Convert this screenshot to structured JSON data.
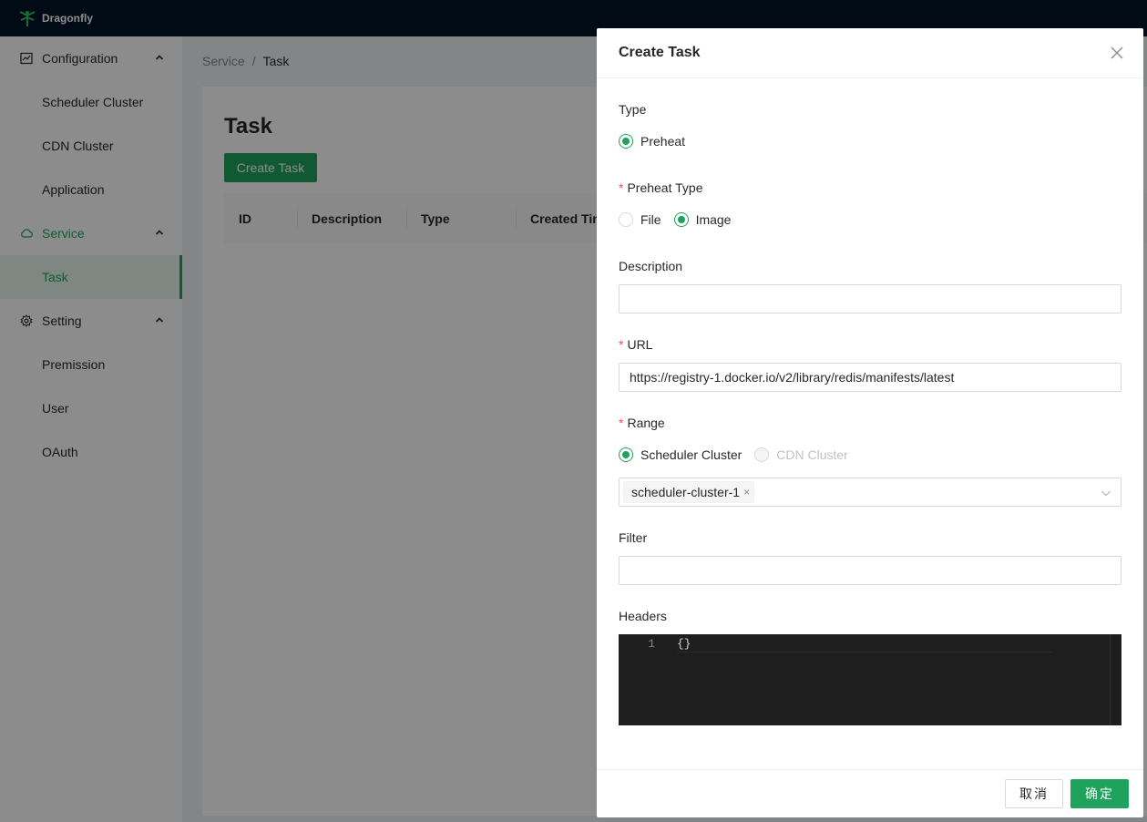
{
  "app": {
    "name": "Dragonfly"
  },
  "sidebar": {
    "items": [
      {
        "label": "Configuration",
        "icon": "chart-icon",
        "type": "group"
      },
      {
        "label": "Scheduler Cluster",
        "type": "sub"
      },
      {
        "label": "CDN Cluster",
        "type": "sub"
      },
      {
        "label": "Application",
        "type": "sub"
      },
      {
        "label": "Service",
        "icon": "cloud-icon",
        "type": "group",
        "active": true
      },
      {
        "label": "Task",
        "type": "sub",
        "selected": true
      },
      {
        "label": "Setting",
        "icon": "gear-icon",
        "type": "group"
      },
      {
        "label": "Premission",
        "type": "sub"
      },
      {
        "label": "User",
        "type": "sub"
      },
      {
        "label": "OAuth",
        "type": "sub"
      }
    ]
  },
  "breadcrumb": {
    "parent": "Service",
    "separator": "/",
    "current": "Task"
  },
  "page": {
    "title": "Task",
    "create_button": "Create Task",
    "table_columns": [
      "ID",
      "Description",
      "Type",
      "Created Time"
    ]
  },
  "modal": {
    "title": "Create Task",
    "type_label": "Type",
    "type_options": [
      {
        "label": "Preheat",
        "checked": true
      }
    ],
    "preheat_type_label": "Preheat Type",
    "preheat_type_options": [
      {
        "label": "File",
        "checked": false
      },
      {
        "label": "Image",
        "checked": true
      }
    ],
    "description_label": "Description",
    "description_value": "",
    "url_label": "URL",
    "url_value": "https://registry-1.docker.io/v2/library/redis/manifests/latest",
    "range_label": "Range",
    "range_options": [
      {
        "label": "Scheduler Cluster",
        "checked": true,
        "disabled": false
      },
      {
        "label": "CDN Cluster",
        "checked": false,
        "disabled": true
      }
    ],
    "selected_clusters": [
      "scheduler-cluster-1"
    ],
    "filter_label": "Filter",
    "filter_value": "",
    "headers_label": "Headers",
    "headers_editor": {
      "line_number": "1",
      "code": "{}"
    },
    "cancel_button": "取消",
    "ok_button": "确定"
  },
  "colors": {
    "primary": "#1fa35c",
    "header_bg": "#001529",
    "required": "#ff4d4f"
  }
}
